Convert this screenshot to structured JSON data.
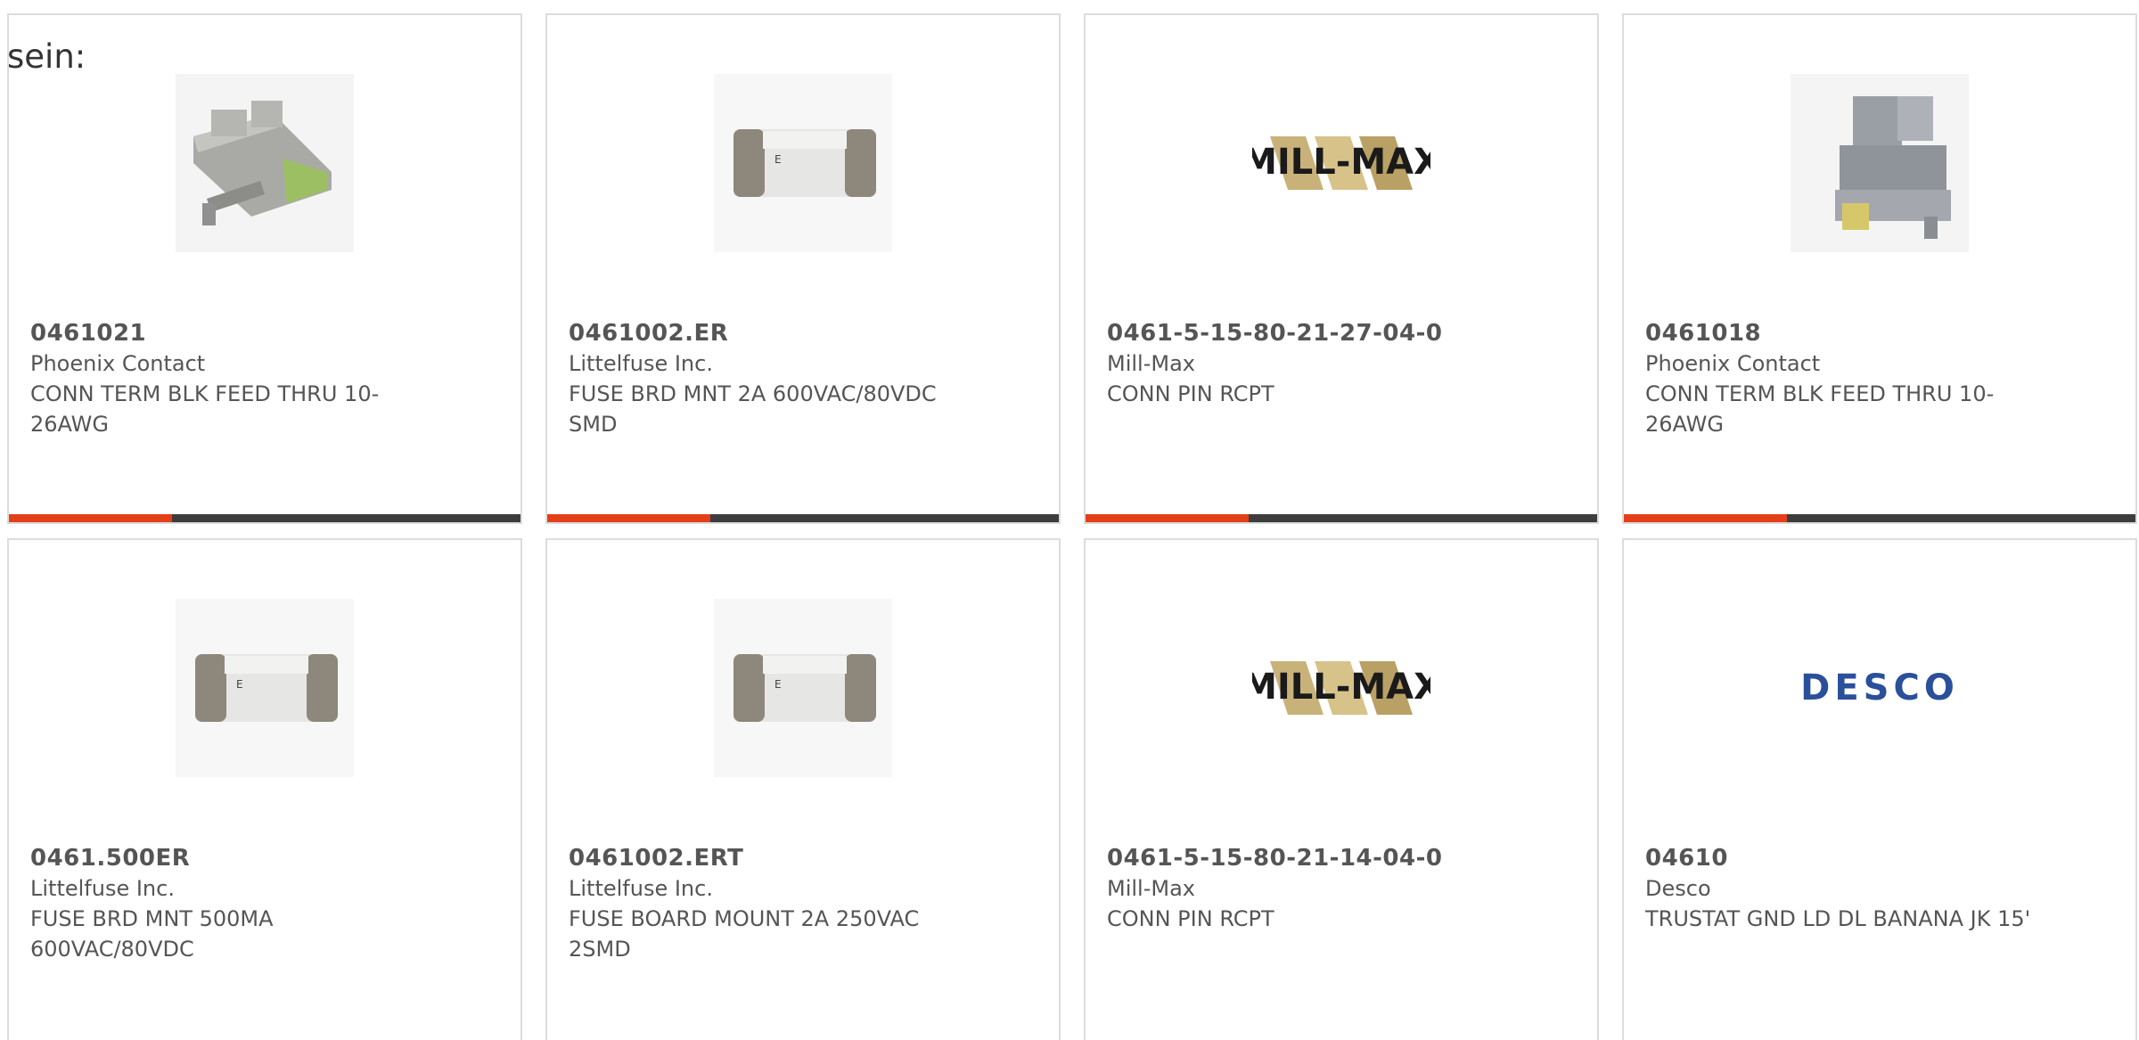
{
  "intro_text": "sein:",
  "products": [
    {
      "part_number": "0461021",
      "manufacturer": "Phoenix Contact",
      "description": "CONN TERM BLK FEED THRU 10-26AWG",
      "image": "terminal-block-flat"
    },
    {
      "part_number": "0461002.ER",
      "manufacturer": "Littelfuse Inc.",
      "description": "FUSE BRD MNT 2A 600VAC/80VDC SMD",
      "image": "fuse"
    },
    {
      "part_number": "0461-5-15-80-21-27-04-0",
      "manufacturer": "Mill-Max",
      "description": "CONN PIN RCPT",
      "image": "mill-max-logo"
    },
    {
      "part_number": "0461018",
      "manufacturer": "Phoenix Contact",
      "description": "CONN TERM BLK FEED THRU 10-26AWG",
      "image": "terminal-block-tall"
    },
    {
      "part_number": "0461.500ER",
      "manufacturer": "Littelfuse Inc.",
      "description": "FUSE BRD MNT 500MA 600VAC/80VDC",
      "image": "fuse"
    },
    {
      "part_number": "0461002.ERT",
      "manufacturer": "Littelfuse Inc.",
      "description": "FUSE BOARD MOUNT 2A 250VAC 2SMD",
      "image": "fuse"
    },
    {
      "part_number": "0461-5-15-80-21-14-04-0",
      "manufacturer": "Mill-Max",
      "description": "CONN PIN RCPT",
      "image": "mill-max-logo"
    },
    {
      "part_number": "04610",
      "manufacturer": "Desco",
      "description": "TRUSTAT GND LD DL BANANA JK 15'",
      "image": "desco-logo"
    }
  ],
  "logos": {
    "mill_max": "MILL-MAX",
    "desco": "DESCO"
  },
  "colors": {
    "accent": "#e3401a",
    "bar": "#3d3d3d",
    "border": "#dcdcdc",
    "text": "#555555",
    "desco_blue": "#2a4f9b"
  }
}
